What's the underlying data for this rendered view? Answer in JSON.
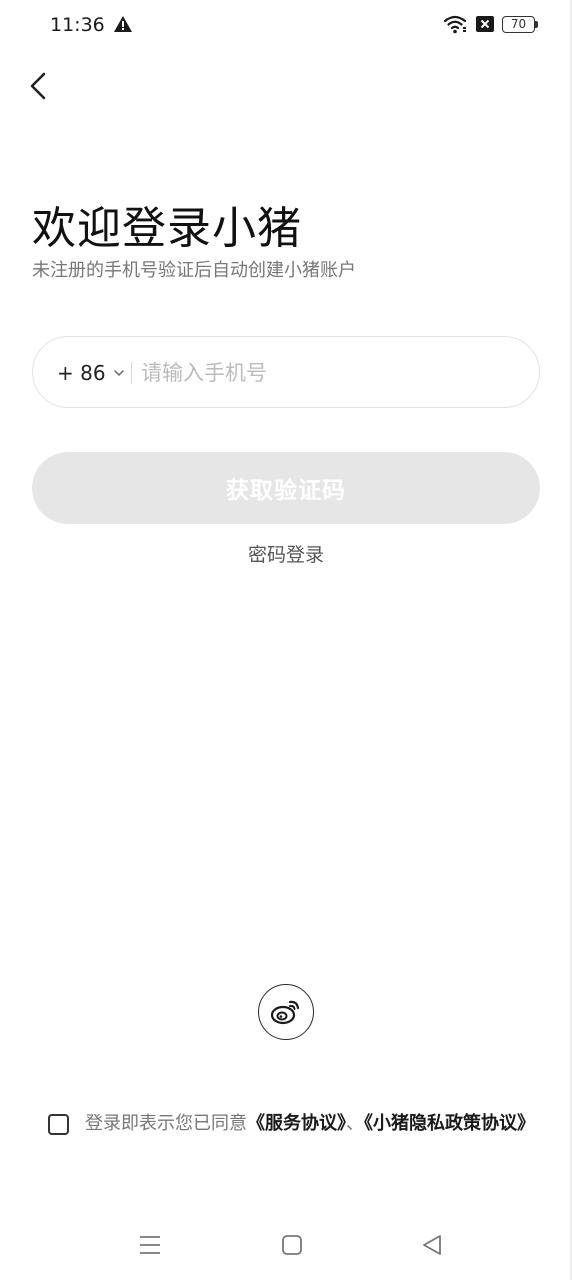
{
  "status_bar": {
    "time": "11:36",
    "battery": "70",
    "icons": [
      "alert-icon",
      "wifi-icon",
      "sim-blocked-icon",
      "battery-icon"
    ]
  },
  "header": {
    "back_icon": "chevron-left-icon"
  },
  "login": {
    "title": "欢迎登录小猪",
    "subtitle": "未注册的手机号验证后自动创建小猪账户",
    "country_code": "+ 86",
    "phone_placeholder": "请输入手机号",
    "phone_value": "",
    "get_code_label": "获取验证码",
    "password_login_label": "密码登录"
  },
  "social": {
    "weibo_icon": "weibo-icon"
  },
  "agreement": {
    "checked": false,
    "prefix": "登录即表示您已同意",
    "service_link": "《服务协议》",
    "separator": "、",
    "privacy_link": "《小猪隐私政策协议》"
  },
  "nav_bar": {
    "icons": [
      "menu-icon",
      "home-icon",
      "back-icon"
    ]
  },
  "colors": {
    "button_disabled_bg": "#e6e6e6",
    "text_primary": "#1a1a1a",
    "text_secondary": "#777777",
    "placeholder": "#bcbcbc"
  }
}
